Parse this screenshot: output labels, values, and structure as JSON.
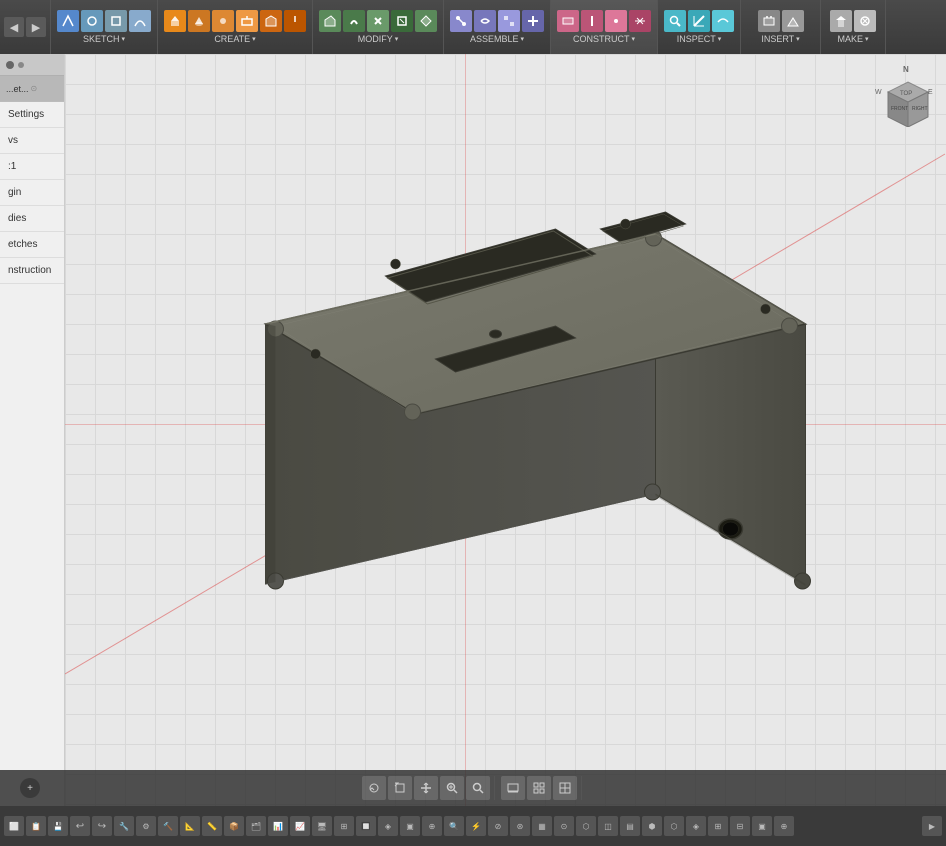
{
  "toolbar": {
    "navBack": "◀",
    "navForward": "▶",
    "groups": [
      {
        "label": "SKETCH",
        "arrow": "▾",
        "icons": [
          "line",
          "arc",
          "circle",
          "rectangle",
          "polygon",
          "spline",
          "project",
          "dimension"
        ]
      },
      {
        "label": "CREATE",
        "arrow": "▾",
        "icons": [
          "extrude",
          "revolve",
          "sweep",
          "loft",
          "hole",
          "thread",
          "box",
          "cylinder"
        ]
      },
      {
        "label": "MODIFY",
        "arrow": "▾",
        "icons": [
          "press-pull",
          "fillet",
          "chamfer",
          "shell",
          "draft",
          "scale",
          "combine",
          "split"
        ]
      },
      {
        "label": "ASSEMBLE",
        "arrow": "▾",
        "icons": [
          "joint",
          "motion",
          "contact",
          "motion-limits",
          "enable",
          "drives",
          "as-built"
        ]
      },
      {
        "label": "CONSTRUCT",
        "arrow": "▾",
        "icons": [
          "plane",
          "axis",
          "point",
          "midplane",
          "offset"
        ]
      },
      {
        "label": "INSPECT",
        "arrow": "▾",
        "icons": [
          "measure",
          "interference",
          "curvature",
          "zebra",
          "draft-analysis"
        ]
      },
      {
        "label": "INSERT",
        "arrow": "▾",
        "icons": [
          "decal",
          "canvas",
          "insert-svg",
          "insert-dxf",
          "mcmaster"
        ]
      },
      {
        "label": "MAKE",
        "arrow": "▾",
        "icons": [
          "3d-print",
          "laser",
          "cnc"
        ]
      }
    ]
  },
  "leftPanel": {
    "topDot": "●",
    "sections": [
      {
        "label": "...et...",
        "hasIcon": true
      },
      {
        "label": "Settings"
      },
      {
        "label": "vs"
      },
      {
        "label": ":1"
      },
      {
        "label": "gin"
      },
      {
        "label": "dies"
      },
      {
        "label": "etches"
      },
      {
        "label": "nstruction"
      }
    ]
  },
  "bottomBar": {
    "expandLabel": "+",
    "iconGroups": [
      [
        "⊕",
        "↔",
        "✋",
        "🔍",
        "🔎"
      ],
      [
        "▭",
        "⊞",
        "⊟"
      ],
      []
    ]
  },
  "viewport": {
    "modelColor": "#636358",
    "modelHighlight": "#7a7a6e",
    "modelShadow": "#4a4a42",
    "gridColor": "#d0d0d0",
    "axisRedColor": "#dd4444"
  },
  "veryBottomStrip": {
    "icons": [
      "⬜",
      "📋",
      "💾",
      "↩",
      "↪",
      "🔧",
      "⚙",
      "🔨",
      "📐",
      "📏",
      "📦",
      "🗂",
      "📊",
      "📈",
      "🖥",
      "⊞",
      "🔲",
      "◈",
      "▣",
      "⊕",
      "🔍",
      "⚡",
      "⊘",
      "⊛",
      "▦",
      "⊙",
      "⬡",
      "◫",
      "▤",
      "⬢",
      "⬡",
      "◈",
      "⊞",
      "⊟",
      "▣",
      "⊕"
    ]
  }
}
